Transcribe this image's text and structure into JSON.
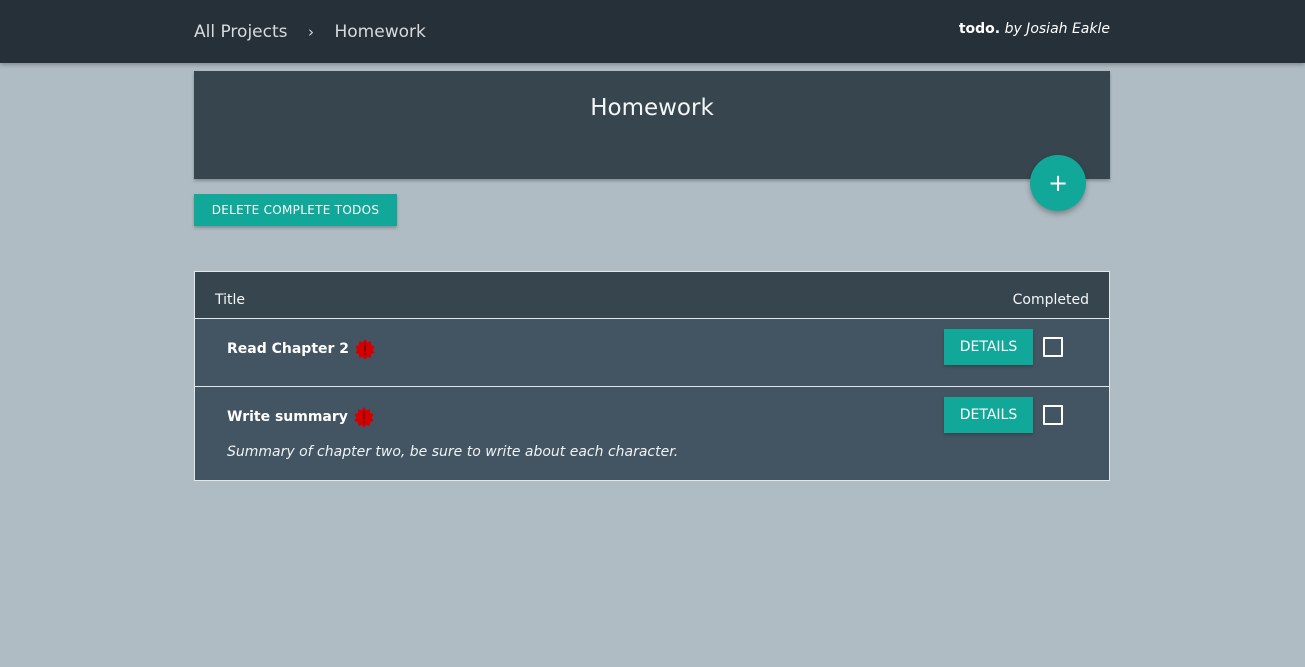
{
  "nav": {
    "breadcrumb": [
      "All Projects",
      "Homework"
    ],
    "separator": "›",
    "brand_name": "todo.",
    "brand_author": "by Josiah Eakle"
  },
  "project": {
    "title": "Homework",
    "add_icon": "plus-icon",
    "add_label": "+"
  },
  "actions": {
    "delete_complete_label": "DELETE COMPLETE TODOS"
  },
  "table": {
    "col_title": "Title",
    "col_completed": "Completed",
    "rows": [
      {
        "title": "Read Chapter 2",
        "description": "",
        "priority_icon": "alert-icon",
        "details_label": "DETAILS",
        "completed": false
      },
      {
        "title": "Write summary",
        "description": "Summary of chapter two, be sure to write about each character.",
        "priority_icon": "alert-icon",
        "details_label": "DETAILS",
        "completed": false
      }
    ]
  },
  "colors": {
    "accent": "#12a899",
    "navbar": "#263038",
    "card": "#37454f",
    "row": "#435562",
    "background": "#b0bcc4",
    "priority": "#d40000"
  }
}
